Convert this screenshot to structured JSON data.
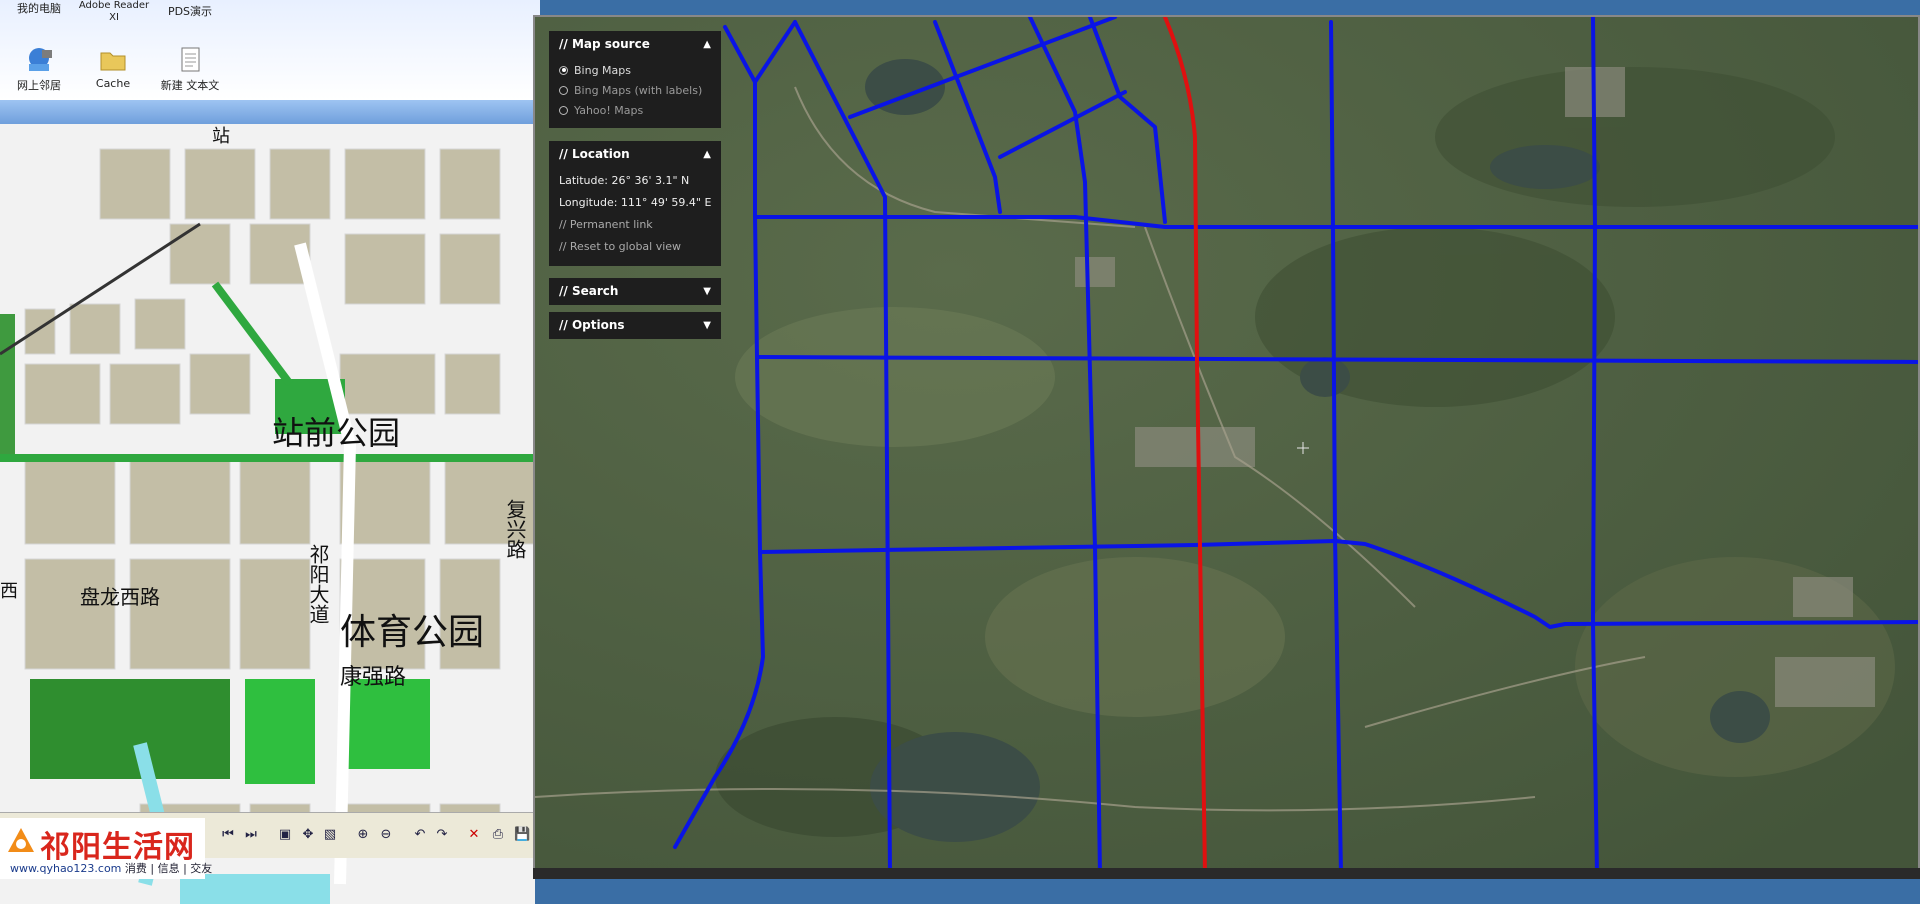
{
  "desktop": {
    "icons": [
      {
        "label": "我的电脑",
        "icon": "my-computer-icon"
      },
      {
        "label": "Adobe Reader XI",
        "icon": "adobe-reader-icon"
      },
      {
        "label": "PDS演示",
        "icon": "pds-demo-icon"
      },
      {
        "label": "网上邻居",
        "icon": "network-places-icon"
      },
      {
        "label": "Cache",
        "icon": "folder-icon"
      },
      {
        "label": "新建 文本文",
        "icon": "text-document-icon"
      }
    ]
  },
  "plan_map": {
    "labels": [
      "站前公园",
      "盘龙西路",
      "体育公园",
      "康强路",
      "祁阳大道",
      "复兴路",
      "西",
      "站"
    ]
  },
  "logo": {
    "brand": "祁阳生活网",
    "url": "www.qyhao123.com",
    "tags": "消费 | 信息 | 交友"
  },
  "map_app": {
    "panels": {
      "map_source": {
        "title": "// Map source",
        "options": [
          {
            "label": "Bing Maps",
            "selected": true
          },
          {
            "label": "Bing Maps (with labels)",
            "selected": false
          },
          {
            "label": "Yahoo! Maps",
            "selected": false
          }
        ]
      },
      "location": {
        "title": "// Location",
        "latitude": "Latitude: 26° 36' 3.1\" N",
        "longitude": "Longitude: 111° 49' 59.4\" E",
        "permanent_link": "// Permanent link",
        "reset": "// Reset to global view"
      },
      "search": {
        "title": "// Search"
      },
      "options": {
        "title": "// Options"
      }
    },
    "colors": {
      "road_overlay": "#0a14e6",
      "highlight_road": "#e01010",
      "panel_bg": "#1e1e1e"
    }
  }
}
